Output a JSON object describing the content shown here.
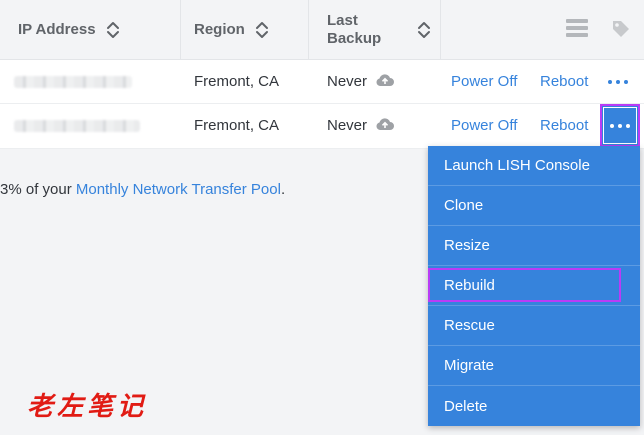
{
  "table": {
    "headers": {
      "ip": "IP Address",
      "region": "Region",
      "backup_line1": "Last",
      "backup_line2": "Backup"
    },
    "icons": {
      "sort": "sort-updown-icon",
      "view": "grid-lines-icon",
      "tags": "tag-icon",
      "cloud": "cloud-upload-icon"
    },
    "rows": [
      {
        "ip": "",
        "region": "Fremont, CA",
        "backup": "Never",
        "power": "Power Off",
        "reboot": "Reboot"
      },
      {
        "ip": "",
        "region": "Fremont, CA",
        "backup": "Never",
        "power": "Power Off",
        "reboot": "Reboot"
      }
    ]
  },
  "transfer": {
    "prefix": "3% of your ",
    "link": "Monthly Network Transfer Pool",
    "suffix": "."
  },
  "menu": {
    "items": [
      "Launch LISH Console",
      "Clone",
      "Resize",
      "Rebuild",
      "Rescue",
      "Migrate",
      "Delete"
    ]
  },
  "watermark": "老左笔记",
  "colors": {
    "accent": "#3683dc",
    "highlight": "#b93cf6",
    "watermark": "#e11b14"
  }
}
